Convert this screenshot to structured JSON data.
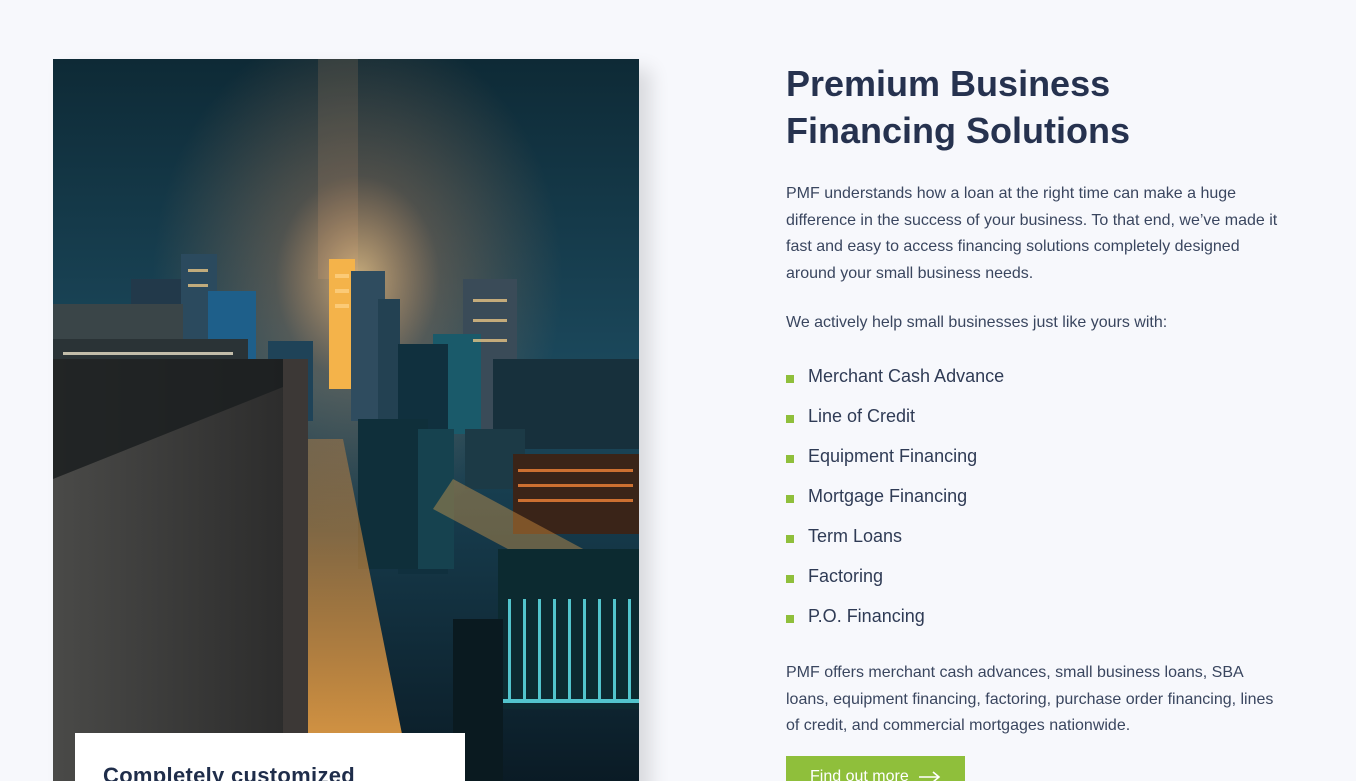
{
  "hero": {
    "image_alt": "Night cityscape with illuminated skyscrapers",
    "caption_title": "Completely customized"
  },
  "content": {
    "title_line1": "Premium Business",
    "title_line2": "Financing Solutions",
    "intro": "PMF understands how a loan at the right time can make a huge difference in the success of your business. To that end, we’ve made it fast and easy to access financing solutions completely designed around your small business needs.",
    "lead_in": "We actively help small businesses just like yours with:",
    "services": [
      "Merchant Cash Advance",
      "Line of Credit",
      "Equipment Financing",
      "Mortgage Financing",
      "Term Loans",
      "Factoring",
      "P.O. Financing"
    ],
    "outro": "PMF offers merchant cash advances, small business loans, SBA loans, equipment financing, factoring, purchase order financing, lines of credit, and commercial mortgages nationwide.",
    "cta_label": "Find out more"
  },
  "icons": {
    "bullet": "square-bullet-icon",
    "cta_arrow": "arrow-right-icon"
  },
  "colors": {
    "background": "#f7f8fc",
    "heading": "#26324f",
    "body_text": "#3a465f",
    "accent_green": "#8fbf3b",
    "card_white": "#ffffff"
  }
}
